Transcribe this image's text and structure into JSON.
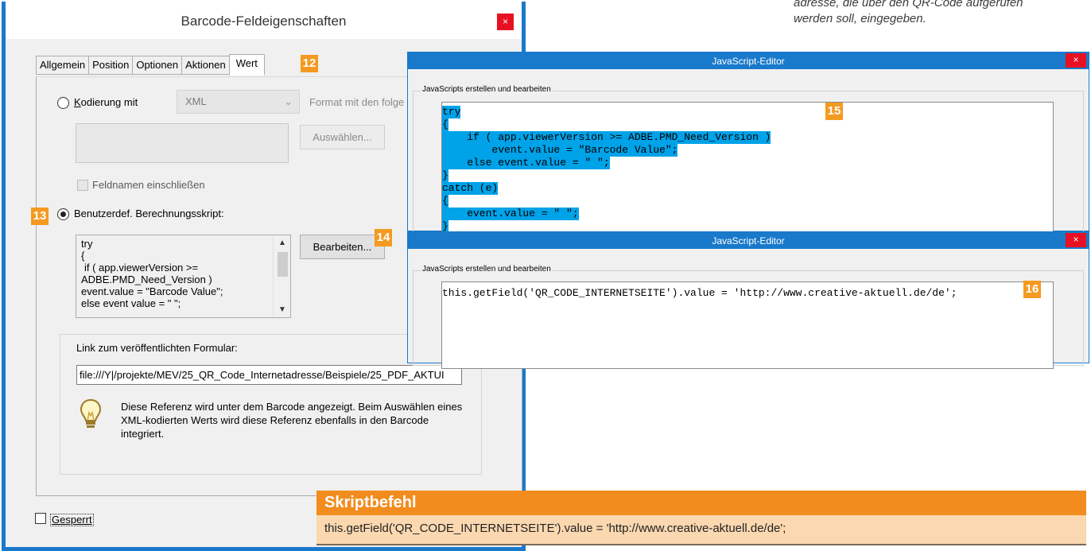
{
  "caption": {
    "line1": "adresse, die über den QR-Code aufgerufen",
    "line2": "werden soll, eingegeben."
  },
  "barcode_dialog": {
    "title": "Barcode-Feldeigenschaften",
    "close_glyph": "×",
    "tabs": [
      "Allgemein",
      "Position",
      "Optionen",
      "Aktionen",
      "Wert"
    ],
    "active_tab": "Wert",
    "encoding_radio_label": "Kodierung mit",
    "encoding_select_value": "XML",
    "format_label": "Format mit den folge",
    "select_button": "Auswählen...",
    "include_fieldnames_label": "Feldnamen einschließen",
    "custom_script_label": "Benutzerdef. Berechnungsskript:",
    "custom_script_lines": [
      "try",
      "{",
      "  if ( app.viewerVersion >=",
      "ADBE.PMD_Need_Version )",
      "      event.value = \"Barcode Value\";",
      "  else event value = \" \";"
    ],
    "edit_button": "Bearbeiten...",
    "link_group_label": "Link zum veröffentlichten Formular:",
    "link_url": "file:///Y|/projekte/MEV/25_QR_Code_Internetadresse/Beispiele/25_PDF_AKTUI",
    "info_text": "Diese Referenz wird unter dem Barcode angezeigt. Beim Auswählen eines XML-kodierten Werts wird diese Referenz ebenfalls in den Barcode integriert.",
    "locked_label": "Gesperrt"
  },
  "badges": {
    "b12": "12",
    "b13": "13",
    "b14": "14",
    "b15": "15",
    "b16": "16"
  },
  "js_editor_1": {
    "title": "JavaScript-Editor",
    "group_label": "JavaScripts erstellen und bearbeiten",
    "code_lines": [
      "try",
      "{",
      "    if ( app.viewerVersion >= ADBE.PMD_Need_Version )",
      "        event.value = \"Barcode Value\";",
      "    else event.value = \" \";",
      "}",
      "catch (e)",
      "{",
      "    event.value = \" \";",
      "}"
    ]
  },
  "js_editor_2": {
    "title": "JavaScript-Editor",
    "group_label": "JavaScripts erstellen und bearbeiten",
    "code_line": "this.getField('QR_CODE_INTERNETSEITE').value = 'http://www.creative-aktuell.de/de';"
  },
  "skriptbefehl": {
    "heading": "Skriptbefehl",
    "command": "this.getField('QR_CODE_INTERNETSEITE').value = 'http://www.creative-aktuell.de/de';"
  },
  "colors": {
    "accent_blue": "#1979ca",
    "badge_orange": "#f49a20",
    "highlight_blue": "#00a2e8",
    "close_red": "#e81123"
  }
}
